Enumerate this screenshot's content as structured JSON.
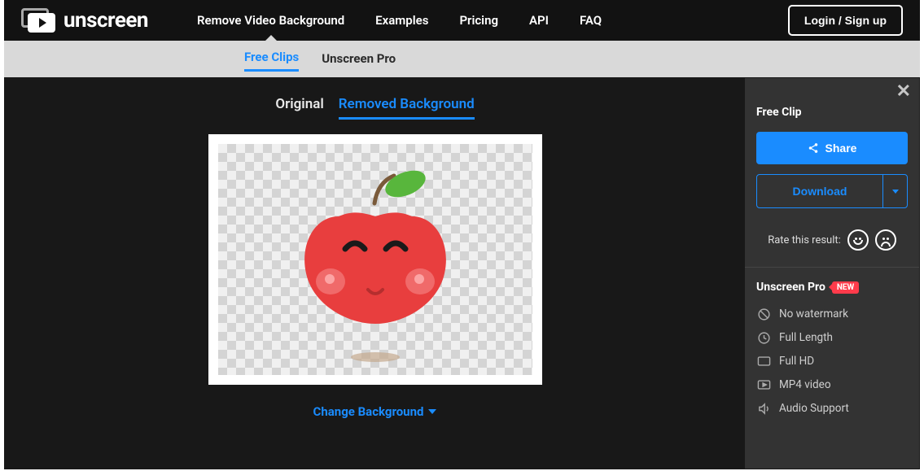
{
  "brand": "unscreen",
  "nav": {
    "remove_bg": "Remove Video Background",
    "examples": "Examples",
    "pricing": "Pricing",
    "api": "API",
    "faq": "FAQ"
  },
  "login_label": "Login / Sign up",
  "subnav": {
    "free_clips": "Free Clips",
    "pro": "Unscreen Pro"
  },
  "view_tabs": {
    "original": "Original",
    "removed": "Removed Background"
  },
  "change_bg": "Change Background",
  "sidebar": {
    "free_clip_title": "Free Clip",
    "share": "Share",
    "download": "Download",
    "rate_label": "Rate this result:",
    "pro_title": "Unscreen Pro",
    "new_badge": "NEW",
    "features": [
      "No watermark",
      "Full Length",
      "Full HD",
      "MP4 video",
      "Audio Support"
    ]
  }
}
